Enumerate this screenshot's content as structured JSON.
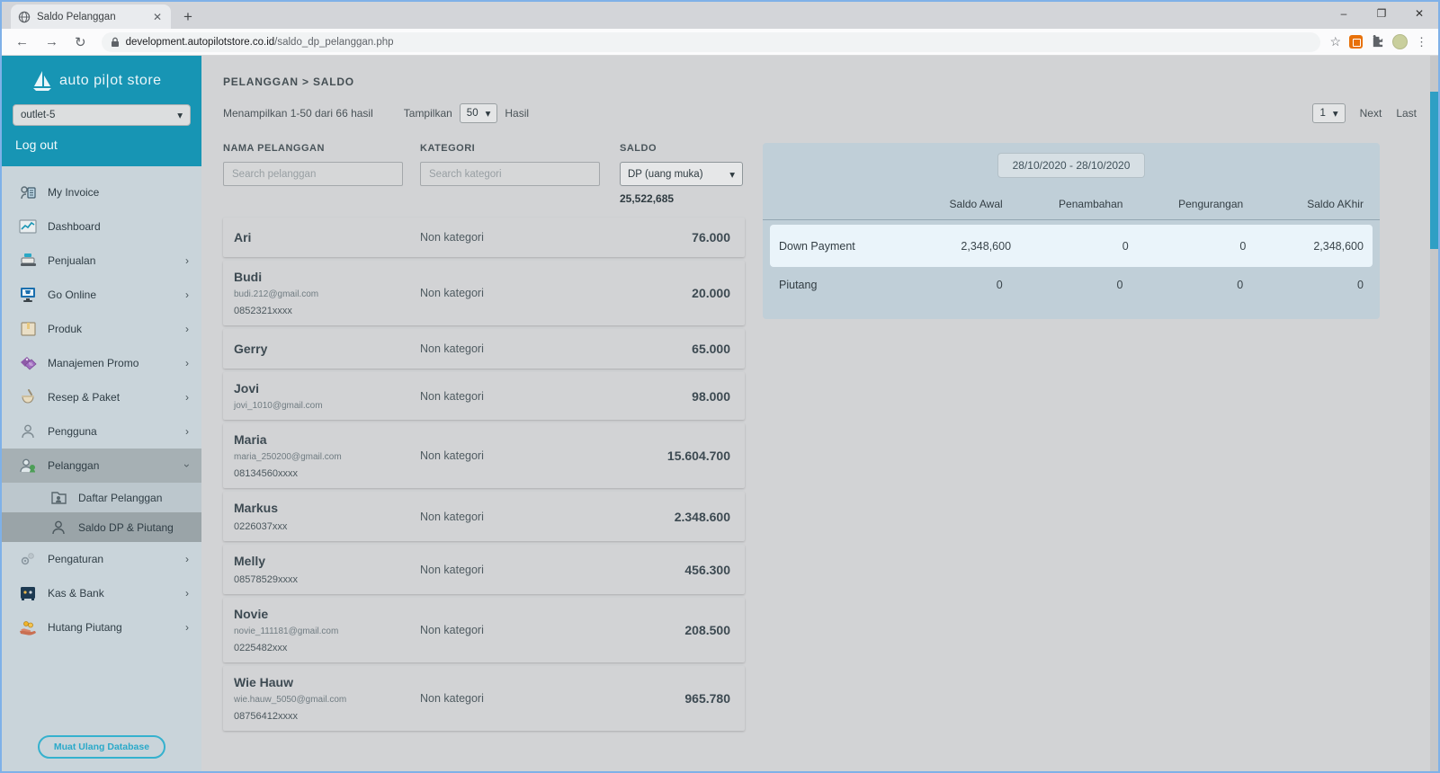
{
  "browser": {
    "tab_title": "Saldo Pelanggan",
    "url_domain": "development.autopilotstore.co.id",
    "url_path": "/saldo_dp_pelanggan.php",
    "controls": {
      "minimize": "–",
      "maximize": "❐",
      "close": "✕"
    },
    "nav": {
      "back": "←",
      "forward": "→",
      "reload": "↻",
      "newtab": "+",
      "tab_close": "✕",
      "star": "☆",
      "dots": "⋮"
    }
  },
  "colors": {
    "accent_teal": "#1795b4",
    "scrollbar": "#2f9fc4",
    "panel_blue": "#c0cfd8",
    "highlight_row": "#eaf4fa",
    "promo_purple": "#8e5aa8",
    "produk_orange": "#e8c87e",
    "coin_yellow": "#f0b429"
  },
  "sidebar": {
    "logo_text": "auto pi|ot store",
    "outlet_select": "outlet-5",
    "logout_label": "Log out",
    "items": [
      {
        "label": "My Invoice",
        "icon": "invoice-icon",
        "chevron": ""
      },
      {
        "label": "Dashboard",
        "icon": "dashboard-icon",
        "chevron": ""
      },
      {
        "label": "Penjualan",
        "icon": "cash-register-icon",
        "chevron": ">"
      },
      {
        "label": "Go Online",
        "icon": "monitor-cart-icon",
        "chevron": ">"
      },
      {
        "label": "Produk",
        "icon": "box-icon",
        "chevron": ">"
      },
      {
        "label": "Manajemen Promo",
        "icon": "promo-tags-icon",
        "chevron": ">"
      },
      {
        "label": "Resep & Paket",
        "icon": "mortar-icon",
        "chevron": ">"
      },
      {
        "label": "Pengguna",
        "icon": "person-icon",
        "chevron": ">"
      },
      {
        "label": "Pelanggan",
        "icon": "people-icon",
        "chevron": "v",
        "state": "expanded"
      },
      {
        "label": "Daftar Pelanggan",
        "icon": "folder-person-icon",
        "sub": true
      },
      {
        "label": "Saldo DP & Piutang",
        "icon": "person-outline-icon",
        "sub": true,
        "state": "selected"
      },
      {
        "label": "Pengaturan",
        "icon": "gears-icon",
        "chevron": ">"
      },
      {
        "label": "Kas & Bank",
        "icon": "safe-icon",
        "chevron": ">"
      },
      {
        "label": "Hutang Piutang",
        "icon": "hand-coins-icon",
        "chevron": ">"
      }
    ],
    "reload_button": "Muat Ulang Database"
  },
  "main": {
    "breadcrumb": "PELANGGAN > SALDO",
    "results_info": "Menampilkan 1-50 dari 66 hasil",
    "tampilkan_label": "Tampilkan",
    "page_size": "50",
    "hasil_label": "Hasil",
    "pagination": {
      "page": "1",
      "next_label": "Next",
      "last_label": "Last"
    },
    "list": {
      "col_nama": "NAMA PELANGGAN",
      "col_kategori": "KATEGORI",
      "col_saldo": "SALDO",
      "search_pelanggan_placeholder": "Search pelanggan",
      "search_kategori_placeholder": "Search kategori",
      "saldo_filter": "DP (uang muka)",
      "saldo_total": "25,522,685",
      "customers": [
        {
          "name": "Ari",
          "email": "",
          "phone": "",
          "category": "Non kategori",
          "saldo": "76.000"
        },
        {
          "name": "Budi",
          "email": "budi.212@gmail.com",
          "phone": "0852321xxxx",
          "category": "Non kategori",
          "saldo": "20.000"
        },
        {
          "name": "Gerry",
          "email": "",
          "phone": "",
          "category": "Non kategori",
          "saldo": "65.000"
        },
        {
          "name": "Jovi",
          "email": "jovi_1010@gmail.com",
          "phone": "",
          "category": "Non kategori",
          "saldo": "98.000"
        },
        {
          "name": "Maria",
          "email": "maria_250200@gmail.com",
          "phone": "08134560xxxx",
          "category": "Non kategori",
          "saldo": "15.604.700"
        },
        {
          "name": "Markus",
          "email": "",
          "phone": "0226037xxx",
          "category": "Non kategori",
          "saldo": "2.348.600"
        },
        {
          "name": "Melly",
          "email": "",
          "phone": "08578529xxxx",
          "category": "Non kategori",
          "saldo": "456.300"
        },
        {
          "name": "Novie",
          "email": "novie_111181@gmail.com",
          "phone": "0225482xxx",
          "category": "Non kategori",
          "saldo": "208.500"
        },
        {
          "name": "Wie Hauw",
          "email": "wie.hauw_5050@gmail.com",
          "phone": "08756412xxxx",
          "category": "Non kategori",
          "saldo": "965.780"
        }
      ]
    },
    "summary": {
      "date_range": "28/10/2020 - 28/10/2020",
      "columns": [
        "Saldo Awal",
        "Penambahan",
        "Pengurangan",
        "Saldo AKhir"
      ],
      "rows": [
        {
          "label": "Down Payment",
          "values": [
            "2,348,600",
            "0",
            "0",
            "2,348,600"
          ],
          "highlighted": true
        },
        {
          "label": "Piutang",
          "values": [
            "0",
            "0",
            "0",
            "0"
          ],
          "highlighted": false
        }
      ]
    }
  }
}
